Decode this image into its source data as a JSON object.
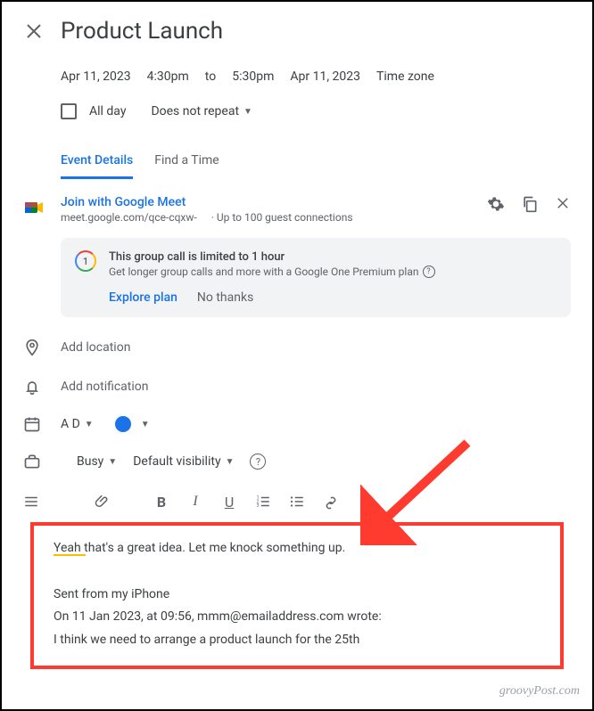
{
  "title": "Product Launch",
  "datetime": {
    "start_date": "Apr 11, 2023",
    "start_time": "4:30pm",
    "to": "to",
    "end_time": "5:30pm",
    "end_date": "Apr 11, 2023",
    "timezone": "Time zone"
  },
  "allday": {
    "label": "All day"
  },
  "repeat": {
    "label": "Does not repeat"
  },
  "tabs": {
    "details": "Event Details",
    "find": "Find a Time"
  },
  "meet": {
    "join": "Join with Google Meet",
    "url": "meet.google.com/qce-cqxw-",
    "limit": "· Up to 100 guest connections"
  },
  "group_call": {
    "title": "This group call is limited to 1 hour",
    "sub": "Get longer group calls and more with a Google One Premium plan",
    "explore": "Explore plan",
    "no": "No thanks"
  },
  "location": {
    "placeholder": "Add location"
  },
  "notification": {
    "placeholder": "Add notification"
  },
  "calendar": {
    "name": "A D"
  },
  "availability": {
    "busy": "Busy",
    "visibility": "Default visibility"
  },
  "description": {
    "line1": "Yeah that's a great idea. Let me knock something up.",
    "line2": "Sent from my iPhone",
    "line3": "On 11 Jan 2023, at 09:56, mmm@emailaddress.com wrote:",
    "line4": "I think we need to arrange a product launch for the 25th"
  },
  "watermark": "groovyPost.com"
}
